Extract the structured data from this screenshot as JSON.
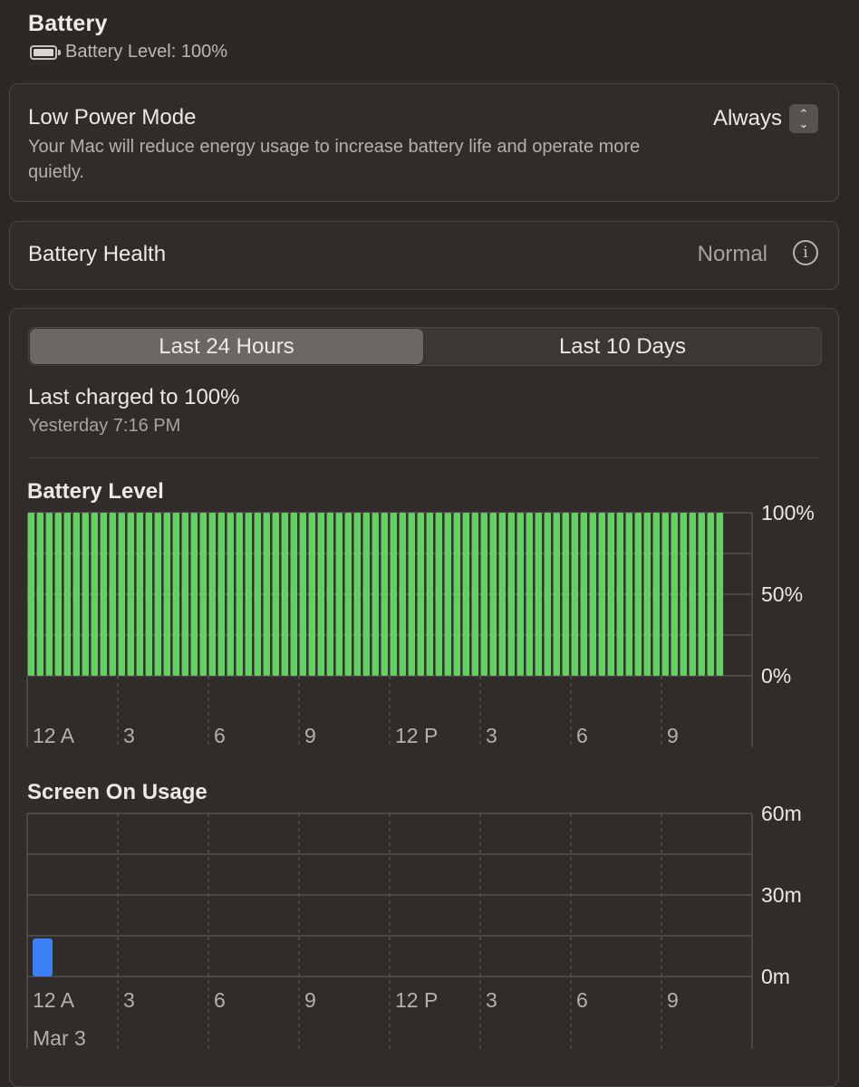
{
  "header": {
    "title": "Battery",
    "battery_level": "Battery Level: 100%"
  },
  "low_power": {
    "title": "Low Power Mode",
    "description": "Your Mac will reduce energy usage to increase battery life and operate more quietly.",
    "value": "Always"
  },
  "battery_health": {
    "label": "Battery Health",
    "value": "Normal"
  },
  "range_tabs": {
    "selected": "Last 24 Hours",
    "tabs": [
      "Last 24 Hours",
      "Last 10 Days"
    ]
  },
  "last_charged": {
    "title": "Last charged to 100%",
    "time": "Yesterday 7:16 PM"
  },
  "colors": {
    "battery_bar": "#61d160",
    "usage_bar": "#3a80f6"
  },
  "chart_data": [
    {
      "type": "bar",
      "title": "Battery Level",
      "x_tick_labels": [
        "12 A",
        "3",
        "6",
        "9",
        "12 P",
        "3",
        "6",
        "9"
      ],
      "y_tick_labels": [
        "100%",
        "50%",
        "0%"
      ],
      "ylim": [
        0,
        100
      ],
      "bar_count": 77,
      "values": [
        100,
        100,
        100,
        100,
        100,
        100,
        100,
        100,
        100,
        100,
        100,
        100,
        100,
        100,
        100,
        100,
        100,
        100,
        100,
        100,
        100,
        100,
        100,
        100,
        100,
        100,
        100,
        100,
        100,
        100,
        100,
        100,
        100,
        100,
        100,
        100,
        100,
        100,
        100,
        100,
        100,
        100,
        100,
        100,
        100,
        100,
        100,
        100,
        100,
        100,
        100,
        100,
        100,
        100,
        100,
        100,
        100,
        100,
        100,
        100,
        100,
        100,
        100,
        100,
        100,
        100,
        100,
        100,
        100,
        100,
        100,
        100,
        100,
        100,
        100,
        100,
        100
      ]
    },
    {
      "type": "bar",
      "title": "Screen On Usage",
      "x_tick_labels": [
        "12 A",
        "3",
        "6",
        "9",
        "12 P",
        "3",
        "6",
        "9"
      ],
      "date_label": "Mar 3",
      "y_tick_labels": [
        "60m",
        "30m",
        "0m"
      ],
      "ylim": [
        0,
        60
      ],
      "values": [
        14,
        0,
        0,
        0,
        0,
        0,
        0,
        0,
        0,
        0,
        0,
        0,
        0,
        0,
        0,
        0,
        0,
        0,
        0,
        0,
        0,
        0,
        0,
        0
      ]
    }
  ]
}
